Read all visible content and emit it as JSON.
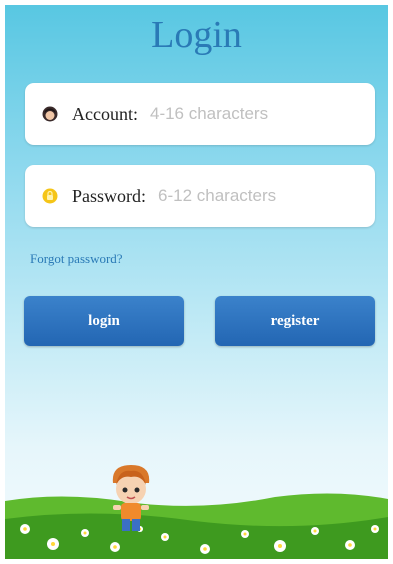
{
  "title": "Login",
  "account": {
    "label": "Account:",
    "placeholder": "4-16 characters",
    "icon": "user-avatar-icon"
  },
  "password": {
    "label": "Password:",
    "placeholder": "6-12 characters",
    "icon": "lock-icon"
  },
  "forgot_link": "Forgot password?",
  "buttons": {
    "login": "login",
    "register": "register"
  },
  "colors": {
    "accent": "#2a7ab6",
    "button": "#2a6fbf",
    "sky_top": "#58c7e2",
    "grass": "#4aa626"
  }
}
